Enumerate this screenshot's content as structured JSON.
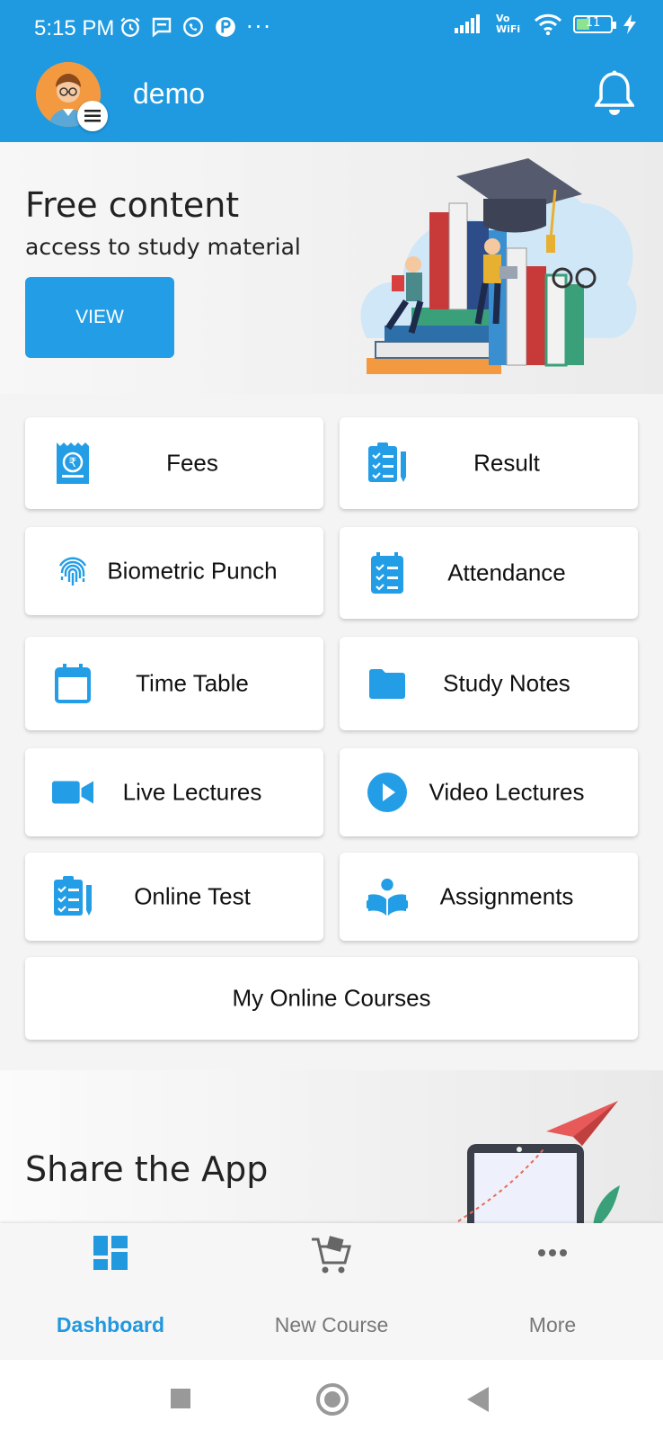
{
  "status_bar": {
    "time": "5:15 PM",
    "vowifi": "Vo WiFi",
    "battery": "11"
  },
  "header": {
    "username": "demo"
  },
  "banner": {
    "title": "Free content",
    "subtitle": "access to study material",
    "button_label": "VIEW"
  },
  "menu": {
    "fees": "Fees",
    "result": "Result",
    "biometric": "Biometric Punch",
    "attendance": "Attendance",
    "timetable": "Time Table",
    "study_notes": "Study Notes",
    "live_lectures": "Live Lectures",
    "video_lectures": "Video Lectures",
    "online_test": "Online Test",
    "assignments": "Assignments",
    "my_courses": "My Online Courses"
  },
  "share": {
    "title": "Share the App"
  },
  "bottom_nav": {
    "dashboard": "Dashboard",
    "new_course": "New Course",
    "more": "More"
  },
  "colors": {
    "primary": "#1f9ae0",
    "accent": "#2298de"
  }
}
